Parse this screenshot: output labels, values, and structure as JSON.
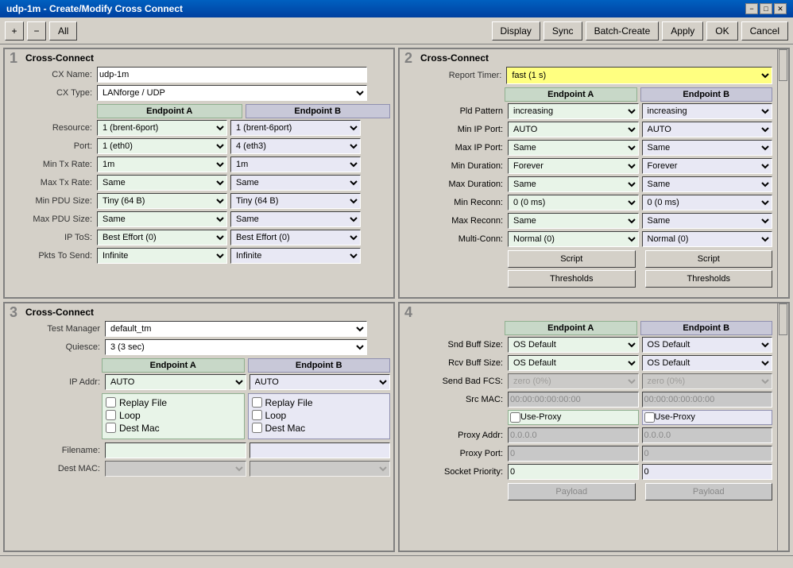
{
  "window": {
    "title": "udp-1m - Create/Modify Cross Connect",
    "title_btn_min": "−",
    "title_btn_max": "□",
    "title_btn_close": "✕"
  },
  "toolbar": {
    "add_label": "+",
    "remove_label": "−",
    "all_label": "All",
    "display_label": "Display",
    "sync_label": "Sync",
    "batch_label": "Batch-Create",
    "apply_label": "Apply",
    "ok_label": "OK",
    "cancel_label": "Cancel"
  },
  "panel1": {
    "number": "1",
    "section_title": "Cross-Connect",
    "cx_name_label": "CX Name:",
    "cx_name_value": "udp-1m",
    "cx_type_label": "CX Type:",
    "cx_type_value": "LANforge / UDP",
    "endpoint_a_label": "Endpoint A",
    "endpoint_b_label": "Endpoint B",
    "resource_label": "Resource:",
    "resource_a": "1 (brent-6port)",
    "resource_b": "1 (brent-6port)",
    "port_label": "Port:",
    "port_a": "1 (eth0)",
    "port_b": "4 (eth3)",
    "min_tx_label": "Min Tx Rate:",
    "min_tx_a": "1m",
    "min_tx_b": "1m",
    "max_tx_label": "Max Tx Rate:",
    "max_tx_a": "Same",
    "max_tx_b": "Same",
    "min_pdu_label": "Min PDU Size:",
    "min_pdu_a": "Tiny      (64 B)",
    "min_pdu_b": "Tiny      (64 B)",
    "max_pdu_label": "Max PDU Size:",
    "max_pdu_a": "Same",
    "max_pdu_b": "Same",
    "ip_tos_label": "IP ToS:",
    "ip_tos_a": "Best Effort   (0)",
    "ip_tos_b": "Best Effort   (0)",
    "pkts_label": "Pkts To Send:",
    "pkts_a": "Infinite",
    "pkts_b": "Infinite"
  },
  "panel2": {
    "number": "2",
    "section_title": "Cross-Connect",
    "report_timer_label": "Report Timer:",
    "report_timer_value": "fast      (1 s)",
    "endpoint_a_label": "Endpoint A",
    "endpoint_b_label": "Endpoint B",
    "pld_label": "Pld Pattern",
    "pld_a": "increasing",
    "pld_b": "increasing",
    "min_ip_label": "Min IP Port:",
    "min_ip_a": "AUTO",
    "min_ip_b": "AUTO",
    "max_ip_label": "Max IP Port:",
    "max_ip_a": "Same",
    "max_ip_b": "Same",
    "min_dur_label": "Min Duration:",
    "min_dur_a": "Forever",
    "min_dur_b": "Forever",
    "max_dur_label": "Max Duration:",
    "max_dur_a": "Same",
    "max_dur_b": "Same",
    "min_reconn_label": "Min Reconn:",
    "min_reconn_a": "0     (0 ms)",
    "min_reconn_b": "0     (0 ms)",
    "max_reconn_label": "Max Reconn:",
    "max_reconn_a": "Same",
    "max_reconn_b": "Same",
    "multi_conn_label": "Multi-Conn:",
    "multi_conn_a": "Normal (0)",
    "multi_conn_b": "Normal (0)",
    "script_label": "Script",
    "thresholds_label": "Thresholds"
  },
  "panel3": {
    "number": "3",
    "section_title": "Cross-Connect",
    "test_mgr_label": "Test Manager",
    "test_mgr_value": "default_tm",
    "quiesce_label": "Quiesce:",
    "quiesce_value": "3 (3 sec)",
    "endpoint_a_label": "Endpoint A",
    "endpoint_b_label": "Endpoint B",
    "ip_addr_label": "IP Addr:",
    "ip_addr_a": "AUTO",
    "ip_addr_b": "AUTO",
    "replay_file_label": "Replay File",
    "loop_label": "Loop",
    "dest_mac_label": "Dest Mac",
    "filename_label": "Filename:",
    "dest_mac2_label": "Dest MAC:"
  },
  "panel4": {
    "number": "4",
    "endpoint_a_label": "Endpoint A",
    "endpoint_b_label": "Endpoint B",
    "snd_buff_label": "Snd Buff Size:",
    "snd_buff_a": "OS Default",
    "snd_buff_b": "OS Default",
    "rcv_buff_label": "Rcv Buff Size:",
    "rcv_buff_a": "OS Default",
    "rcv_buff_b": "OS Default",
    "bad_fcs_label": "Send Bad FCS:",
    "bad_fcs_a": "zero (0%)",
    "bad_fcs_b": "zero (0%)",
    "src_mac_label": "Src MAC:",
    "src_mac_a": "00:00:00:00:00:00",
    "src_mac_b": "00:00:00:00:00:00",
    "use_proxy_label": "Use-Proxy",
    "proxy_addr_label": "Proxy Addr:",
    "proxy_addr_a": "0.0.0.0",
    "proxy_addr_b": "0.0.0.0",
    "proxy_port_label": "Proxy Port:",
    "proxy_port_a": "0",
    "proxy_port_b": "0",
    "socket_pri_label": "Socket Priority:",
    "socket_pri_a": "0",
    "socket_pri_b": "0",
    "payload_label": "Payload"
  }
}
